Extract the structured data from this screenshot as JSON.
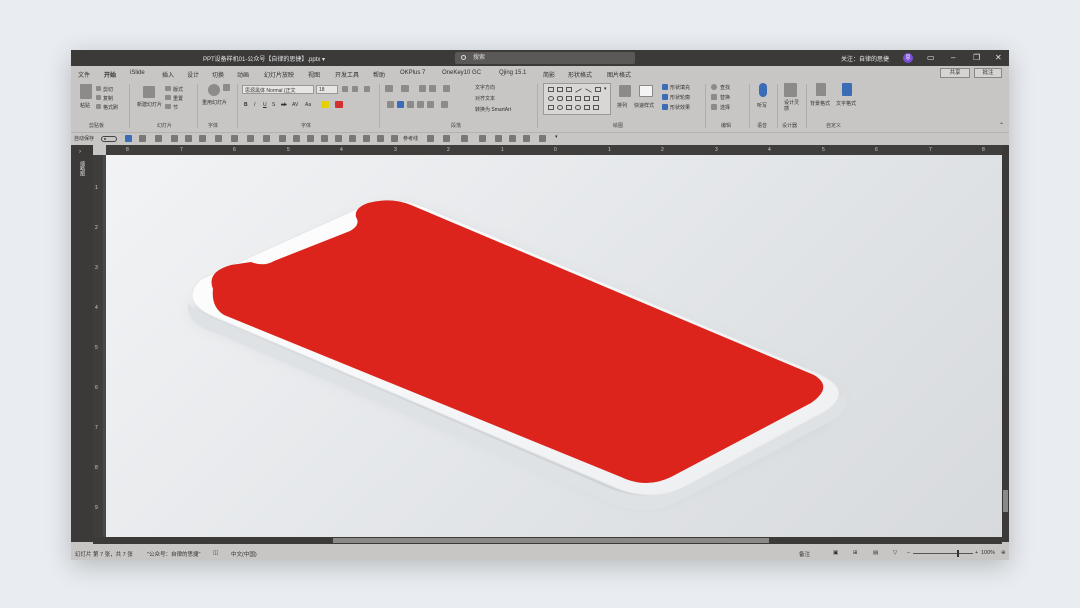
{
  "titlebar": {
    "title": "PPT设备样机01-公众号【自律的思捷】.pptx  ▾",
    "search": "搜索",
    "follow": "关注：自律的思捷",
    "avatar": "思"
  },
  "menu": {
    "tabs": [
      "文件",
      "开始",
      "iSlide",
      "插入",
      "设计",
      "切换",
      "动画",
      "幻灯片放映",
      "视图",
      "开发工具",
      "帮助",
      "OKPlus 7",
      "OneKey10 GC",
      "Qjing 15.1",
      "简影",
      "形状格式",
      "图片格式"
    ],
    "active": "开始",
    "share": "共享",
    "comment": "批注"
  },
  "ribbon": {
    "clipboard": {
      "paste": "粘贴",
      "cut": "剪切",
      "copy": "复制",
      "format_painter": "格式刷",
      "group": "剪贴板"
    },
    "slides": {
      "new": "新建幻灯片",
      "layout": "版式",
      "reset": "重置",
      "section": "节",
      "group": "幻灯片"
    },
    "font_tools": {
      "reuse": "重用幻灯片",
      "group": "字体"
    },
    "font": {
      "name": "思源黑体 Normal (正文",
      "size": "18",
      "group": "字体"
    },
    "paragraph": {
      "text_direction": "文字方向",
      "align_text": "对齐文本",
      "smartart": "转换为 SmartArt",
      "group": "段落"
    },
    "drawing": {
      "arrange": "排列",
      "quick_styles": "快速样式",
      "fill": "形状填充",
      "outline": "形状轮廓",
      "effects": "形状效果",
      "group": "绘图"
    },
    "editing": {
      "find": "查找",
      "replace": "替换",
      "select": "选择",
      "group": "编辑"
    },
    "voice": {
      "dictate": "听写",
      "group": "语音"
    },
    "designer": {
      "ideas": "设计灵感",
      "group": "设计器"
    },
    "custom": {
      "bg": "背景格式",
      "text": "文字格式",
      "group": "自定义"
    }
  },
  "qat": {
    "autosave": "自动保存",
    "toggle_state": "关",
    "ref": "参考线"
  },
  "ruler": {
    "h": [
      "8",
      "7",
      "6",
      "5",
      "4",
      "3",
      "2",
      "1",
      "0",
      "1",
      "2",
      "3",
      "4",
      "5",
      "6",
      "7",
      "8"
    ],
    "v": [
      "1",
      "2",
      "3",
      "4",
      "5",
      "6",
      "7",
      "8",
      "9"
    ]
  },
  "leftpane": {
    "label": "缩略图"
  },
  "status": {
    "slide_info": "幻灯片 第 7 张，共 7 张",
    "theme": "\"公众号：自律的思捷\"",
    "lang": "中文(中国)",
    "notes": "备注",
    "zoom": "100%"
  },
  "colors": {
    "screen": "#dc241c",
    "device_body": "#fafafa",
    "titlebar": "#3b3a39",
    "ribbon": "#c8c6c4"
  }
}
